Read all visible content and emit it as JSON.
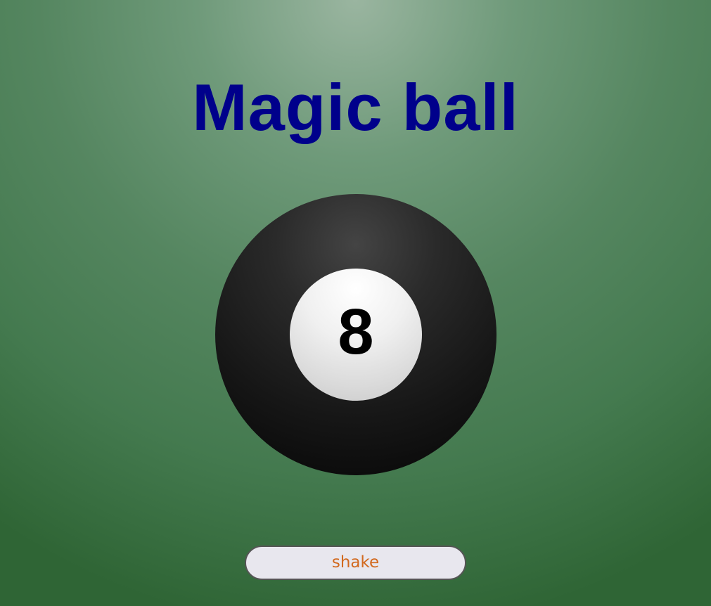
{
  "title": {
    "text": "Magic ball",
    "color": "#00008b"
  },
  "ball": {
    "number": "8"
  },
  "shake_button": {
    "label": "shake",
    "text_color": "#d2691e"
  }
}
